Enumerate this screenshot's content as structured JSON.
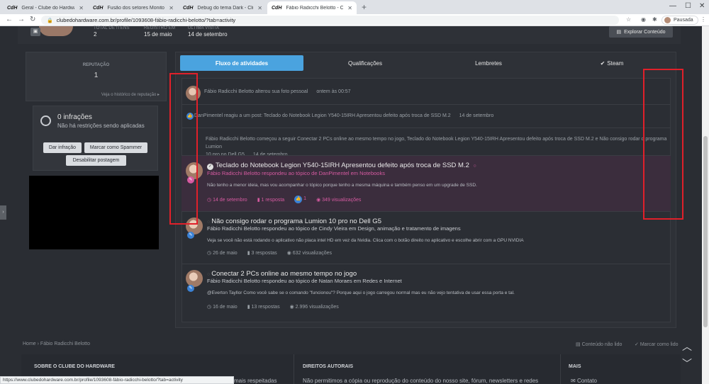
{
  "browser": {
    "tabs": [
      {
        "favicon": "CdH",
        "title": "Geral - Clube do Hardware",
        "active": false
      },
      {
        "favicon": "CdH",
        "title": "Fusão dos setores Monitores com",
        "active": false
      },
      {
        "favicon": "CdH",
        "title": "Debug do tema Dark - Clu",
        "active": false
      },
      {
        "favicon": "CdH",
        "title": "Fábio Radicchi Belotto - Clube d",
        "active": true
      }
    ],
    "new_tab": "+",
    "url": "clubedohardware.com.br/profile/1093608-fábio-radicchi-belotto/?tab=activity",
    "profile_label": "Pausada",
    "status_url": "https://www.clubedohardware.com.br/profile/1093608-fábio-radicchi-belotto/?tab=activity"
  },
  "profile": {
    "stats": [
      {
        "label": "TOTAL DE ITENS",
        "value": "2"
      },
      {
        "label": "REGISTRO EM",
        "value": "15 de maio"
      },
      {
        "label": "ÚLTIMA VISITA",
        "value": "14 de setembro"
      }
    ],
    "explore_button": "Explorar Conteúdo"
  },
  "sidebar": {
    "reputation_title": "REPUTAÇÃO",
    "reputation_value": "1",
    "reputation_link": "Veja o histórico de reputação",
    "infractions_title": "0 infrações",
    "infractions_sub": "Não há restrições sendo aplicadas",
    "btn_infraction": "Dar infração",
    "btn_spammer": "Marcar como Spammer",
    "btn_disable": "Desabilitar postagem"
  },
  "tabs": [
    "Fluxo de atividades",
    "Qualificações",
    "Lembretes",
    "Steam"
  ],
  "feed": {
    "simple": [
      {
        "text": "Fábio Radicchi Belotto alterou sua foto pessoal",
        "time": "ontem às 00:57"
      },
      {
        "text": "DanPimentel reagiu a um post: Teclado do Notebook Legion Y540-15IRH Apresentou defeito após troca de SSD M.2",
        "time": "14 de setembro"
      },
      {
        "text": "Fábio Radicchi Belotto começou a seguir Conectar 2 PCs online ao mesmo tempo no jogo, Teclado do Notebook Legion Y540-15IRH Apresentou defeito após troca de SSD M.2 e Não consigo rodar o programa Lumion",
        "text2": "10 pro no Dell G5",
        "time": "14 de setembro"
      }
    ],
    "items": [
      {
        "title": "Teclado do Notebook Legion Y540-15IRH Apresentou defeito após troca de SSD M.2",
        "sub": "Fábio Radicchi Belotto respondeu ao tópico de DanPimentel em Notebooks",
        "body": "Não tenho a menor ideia, mas vou acompanhar o tópico porque tenho a mesma máquina e também penso em um upgrade de SSD.",
        "date": "14 de setembro",
        "replies": "1 resposta",
        "likes": "1",
        "views": "349 visualizações"
      },
      {
        "title": "Não consigo rodar o programa Lumion 10 pro no Dell G5",
        "sub": "Fábio Radicchi Belotto respondeu ao tópico de Cindy Vieira em Design, animação e tratamento de imagens",
        "body": "Veja se você não está rodando o aplicativo não placa intel HD em vez da Nvidia. Clica com o botão direito no aplicativo e escolhe abrir com a GPU NVIDIA",
        "date": "26 de maio",
        "replies": "3 respostas",
        "views": "632 visualizações"
      },
      {
        "title": "Conectar 2 PCs online ao mesmo tempo no jogo",
        "sub": "Fábio Radicchi Belotto respondeu ao tópico de Natan Moraes em Redes e Internet",
        "body": "@Everton Tayllor Como você sabe se o comando \"funcionou\"? Porque aqui o jogo carregou normal mas eu não vejo tentativa de usar essa porta e tal.",
        "date": "16 de maio",
        "replies": "13 respostas",
        "views": "2.996 visualizações"
      }
    ]
  },
  "breadcrumb": {
    "home": "Home",
    "current": "Fábio Radicchi Belotto"
  },
  "footer_links": {
    "unread": "Conteúdo não lido",
    "mark_read": "Marcar como lido"
  },
  "footer": {
    "col1_title": "SOBRE O CLUBE DO HARDWARE",
    "col1_text": "mais respeitadas",
    "col2_title": "DIREITOS AUTORAIS",
    "col2_text": "Não permitimos a cópia ou reprodução do conteúdo do nosso site, fórum, newsletters e redes",
    "col3_title": "MAIS",
    "col3_text": "Contato"
  },
  "colors": {
    "accent": "#4aa3df",
    "highlight_row": "#3b2d3d",
    "pink": "#d65aa1",
    "annotation": "#e0202a"
  }
}
